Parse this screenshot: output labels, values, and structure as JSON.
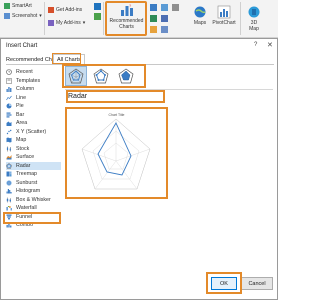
{
  "ribbon": {
    "smartart_label": "SmartArt",
    "screenshot_label": "Screenshot",
    "get_addins_label": "Get Add-ins",
    "my_addins_label": "My Add-ins",
    "recommended_charts_line1": "Recommended",
    "recommended_charts_line2": "Charts",
    "maps_label": "Maps",
    "pivotchart_label": "PivotChart",
    "map3d_line1": "3D",
    "map3d_line2": "Map"
  },
  "dialog": {
    "title": "Insert Chart",
    "help_glyph": "?",
    "close_glyph": "✕",
    "tabs": {
      "recommended": "Recommended Charts",
      "all": "All Charts"
    },
    "categories": [
      {
        "label": "Recent",
        "icon": "recent-icon"
      },
      {
        "label": "Templates",
        "icon": "templates-icon"
      },
      {
        "label": "Column",
        "icon": "column-chart-icon"
      },
      {
        "label": "Line",
        "icon": "line-chart-icon"
      },
      {
        "label": "Pie",
        "icon": "pie-chart-icon"
      },
      {
        "label": "Bar",
        "icon": "bar-chart-icon"
      },
      {
        "label": "Area",
        "icon": "area-chart-icon"
      },
      {
        "label": "X Y (Scatter)",
        "icon": "scatter-chart-icon"
      },
      {
        "label": "Map",
        "icon": "map-chart-icon"
      },
      {
        "label": "Stock",
        "icon": "stock-chart-icon"
      },
      {
        "label": "Surface",
        "icon": "surface-chart-icon"
      },
      {
        "label": "Radar",
        "icon": "radar-chart-icon"
      },
      {
        "label": "Treemap",
        "icon": "treemap-chart-icon"
      },
      {
        "label": "Sunburst",
        "icon": "sunburst-chart-icon"
      },
      {
        "label": "Histogram",
        "icon": "histogram-chart-icon"
      },
      {
        "label": "Box & Whisker",
        "icon": "box-whisker-chart-icon"
      },
      {
        "label": "Waterfall",
        "icon": "waterfall-chart-icon"
      },
      {
        "label": "Funnel",
        "icon": "funnel-chart-icon"
      },
      {
        "label": "Combo",
        "icon": "combo-chart-icon"
      }
    ],
    "selected_category": "Radar",
    "subtypes": [
      "Radar",
      "Radar with Markers",
      "Filled Radar"
    ],
    "subtype_heading": "Radar",
    "preview_title": "Chart Title",
    "ok_label": "OK",
    "cancel_label": "Cancel"
  },
  "colors": {
    "highlight": "#e38a2a",
    "selection": "#cfe3f5",
    "accent": "#0078d7"
  }
}
